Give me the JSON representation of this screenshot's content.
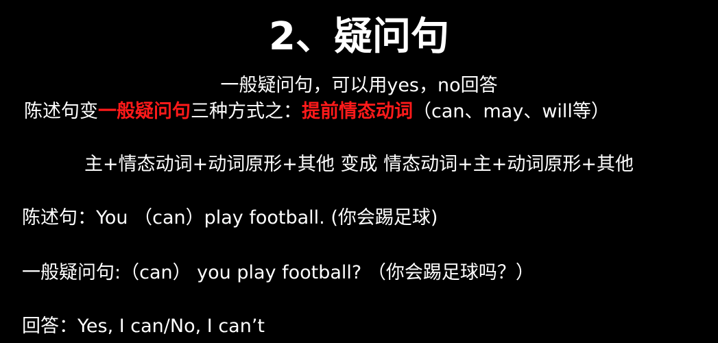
{
  "slide": {
    "title": "2、疑问句",
    "intro": "一般疑问句，可以用yes，no回答",
    "ways": {
      "prefix": "陈述句变",
      "highlight_1": "一般疑问句",
      "middle": "三种方式之：",
      "highlight_2": "提前情态动词",
      "suffix": "（can、may、will等）"
    },
    "formula": "主+情态动词+动词原形+其他 变成 情态动词+主+动词原形+其他",
    "statement": "陈述句：You （can）play football. (你会踢足球)",
    "question": "一般疑问句:（can） you play football? （你会踢足球吗？）",
    "answer": "回答：Yes, I can/No, I can’t",
    "colors": {
      "background": "#000000",
      "text": "#ffffff",
      "highlight": "#ff1a1a"
    }
  }
}
